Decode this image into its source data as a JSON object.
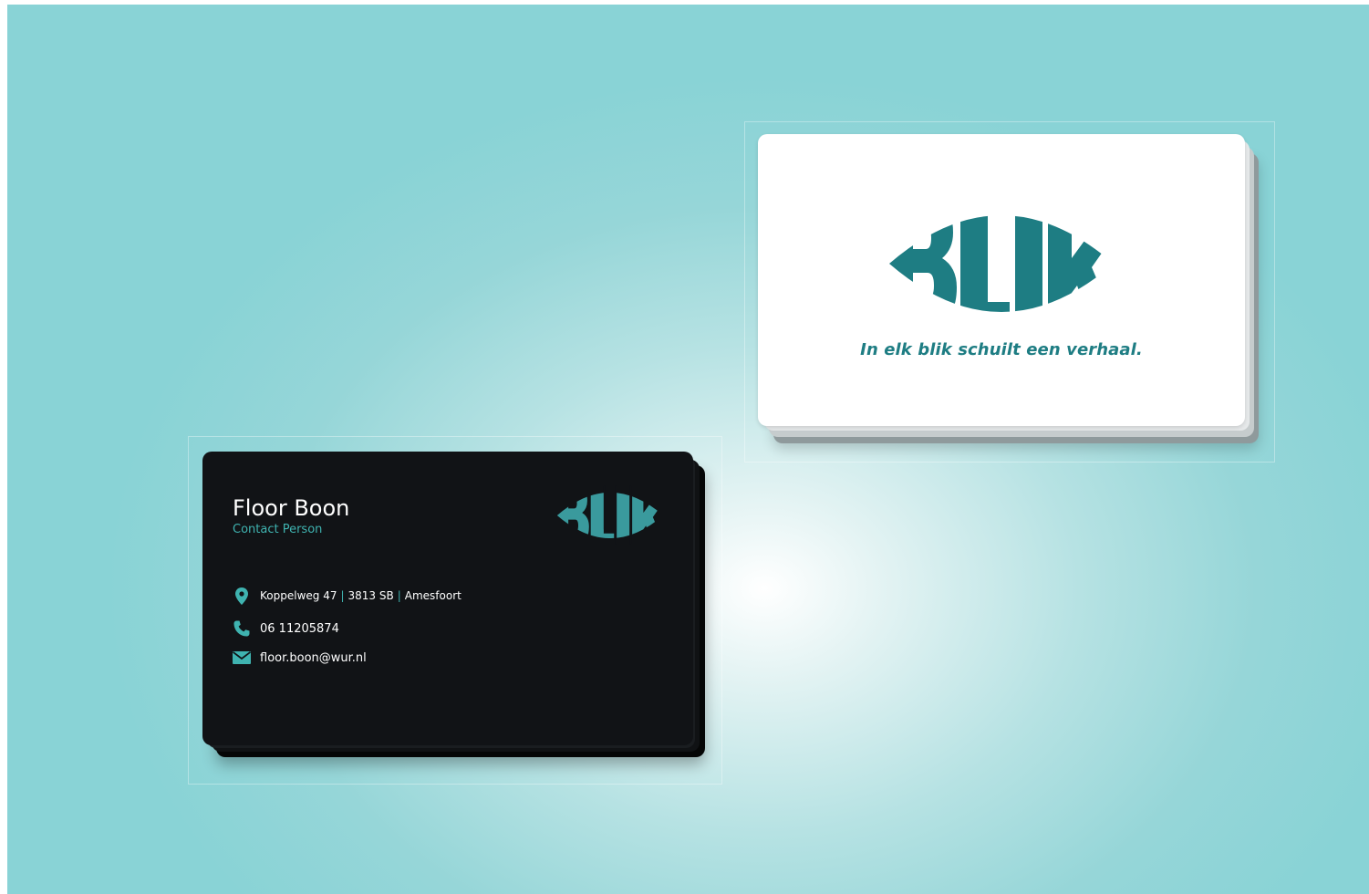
{
  "brand": {
    "logo_text": "BLIK",
    "tagline": "In elk blik schuilt een verhaal."
  },
  "contact": {
    "name": "Floor Boon",
    "role": "Contact Person",
    "address_street": "Koppelweg 47",
    "address_zip": "3813 SB",
    "address_city": "Amesfoort",
    "separator": "|",
    "phone": "06 11205874",
    "email": "floor.boon@wur.nl"
  },
  "icons": {
    "address": "map-pin-icon",
    "phone": "phone-icon",
    "email": "mail-icon"
  },
  "colors": {
    "teal_dark": "#1e7d83",
    "teal_light": "#3fb3b0",
    "card_dark": "#111316",
    "background": "#89d3d6"
  }
}
